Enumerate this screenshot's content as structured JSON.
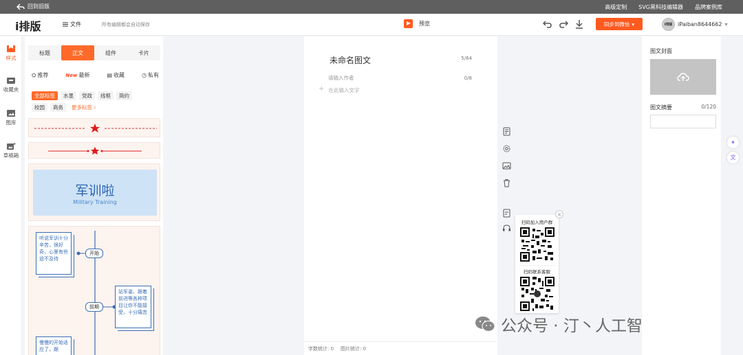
{
  "topbar": {
    "back_label": "回到旧版",
    "links": [
      "高级定制",
      "SVG黑科技编辑器",
      "品牌案例库"
    ]
  },
  "header": {
    "logo_i": "i",
    "logo_text": "排版",
    "file_menu": "文件",
    "autosave": "所有编辑都会自动保存",
    "preview": "预览",
    "sync_button": "同步到微信",
    "username": "iPaiban8644662",
    "avatar_text": "i排版"
  },
  "rail": {
    "items": [
      "样式",
      "收藏夹",
      "图库",
      "草稿箱"
    ]
  },
  "panel": {
    "tabs": [
      "标题",
      "正文",
      "组件",
      "卡片"
    ],
    "subtabs": {
      "recommend": "推荐",
      "new_badge": "New",
      "latest": "最新",
      "collect": "收藏",
      "private": "私有"
    },
    "tags_row1": [
      "全部标签",
      "水墨",
      "党政",
      "线框",
      "简约"
    ],
    "tags_row2": [
      "校园",
      "商务",
      "更多标签 ›"
    ],
    "banner": {
      "cn": "军训啦",
      "en": "Military Training"
    },
    "flow": {
      "box1": "听说军训十分辛苦，很好奇，心里有些迫不及待",
      "start": "开始",
      "box2": "站军姿、跟着前进等各种项目让你不能接受，十分痛苦",
      "early": "前期",
      "box3": "慢慢的开始适应了，跟"
    }
  },
  "editor": {
    "title": "未命名图文",
    "title_count": "5/64",
    "author_placeholder": "请输入作者",
    "author_count": "0/8",
    "body_placeholder": "在此输入文字",
    "footer_words": "字数统计: 0",
    "footer_images": "图片统计: 0"
  },
  "qr": {
    "group_label": "扫码加入用户群",
    "service_label": "扫码联系客服"
  },
  "right": {
    "cover_label": "图文封面",
    "summary_label": "图文摘要",
    "summary_count": "0/120"
  },
  "watermark": {
    "text": "公众号 · 汀丶人工智能"
  },
  "colors": {
    "accent": "#ff5a1f",
    "topbar": "#5f5f5f",
    "flow_blue": "#3a6fb5",
    "banner_bg": "#cfe3f6"
  }
}
